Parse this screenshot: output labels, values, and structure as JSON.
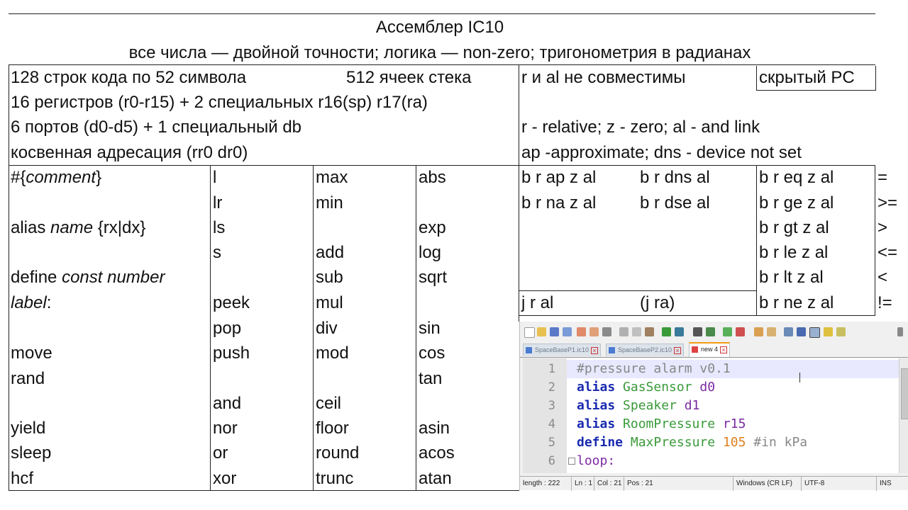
{
  "header": {
    "title": "Ассемблер IC10",
    "subtitle": "все числа — двойной точности;   логика — non-zero;   тригонометрия в радианах"
  },
  "info": {
    "lines_code": "128 строк кода по 52 символа",
    "stack": "512 ячеек стека",
    "registers": "16 регистров (r0-r15) + 2 специальных r16(sp) r17(ra)",
    "ports": "6 портов (d0-d5) + 1 специальный db",
    "indirect": "косвенная адресация (rr0 dr0)",
    "r_al": "r и al не совместимы",
    "hidden_pc": "скрытый PC",
    "legend1": "r - relative;  z - zero;  al - and link",
    "legend2": "ap -approximate;  dns - device not set"
  },
  "col1": {
    "comment_hash": "#{",
    "comment_word": "comment",
    "comment_end": "}",
    "alias_kw": "alias ",
    "alias_name": "name",
    "alias_args": " {rx|dx}",
    "define_kw": "define ",
    "define_args": "const number",
    "label_word": "label",
    "label_colon": ":",
    "move": "move",
    "rand": "rand",
    "yield": "yield",
    "sleep": "sleep",
    "hcf": "hcf"
  },
  "col2": {
    "l": "l",
    "lr": "lr",
    "ls": "ls",
    "s": "s",
    "peek": "peek",
    "pop": "pop",
    "push": "push",
    "and": "and",
    "nor": "nor",
    "or": "or",
    "xor": "xor"
  },
  "col3": {
    "max": "max",
    "min": "min",
    "add": "add",
    "sub": "sub",
    "mul": "mul",
    "div": "div",
    "mod": "mod",
    "ceil": "ceil",
    "floor": "floor",
    "round": "round",
    "trunc": "trunc"
  },
  "col4": {
    "abs": "abs",
    "exp": "exp",
    "log": "log",
    "sqrt": "sqrt",
    "sin": "sin",
    "cos": "cos",
    "tan": "tan",
    "asin": "asin",
    "acos": "acos",
    "atan": "atan"
  },
  "branch": {
    "bap": "b r ap z al",
    "bdns": "b r dns al",
    "beq": "b r eq z al",
    "eq_sym": "=",
    "bna": "b r na z al",
    "bdse": "b r dse al",
    "bge": "b r ge z al",
    "ge_sym": ">=",
    "bgt": "b r gt z al",
    "gt_sym": ">",
    "ble": "b r le z al",
    "le_sym": "<=",
    "blt": "b r lt z al",
    "lt_sym": "<",
    "jral": "j r al",
    "jra": "(j ra)",
    "bne": "b r ne z al",
    "ne_sym": "!="
  },
  "editor": {
    "tabs": [
      "SpaceBaseP1.ic10",
      "SpaceBaseP2.ic10",
      "new 4"
    ],
    "line_numbers": [
      "1",
      "2",
      "3",
      "4",
      "5",
      "6"
    ],
    "code": {
      "l1": "#pressure alarm v0.1",
      "l2_kw": "alias",
      "l2_id": " GasSensor",
      "l2_arg": " d0",
      "l3_kw": "alias",
      "l3_id": " Speaker",
      "l3_arg": " d1",
      "l4_kw": "alias",
      "l4_id": " RoomPressure",
      "l4_arg": " r15",
      "l5_kw": "define",
      "l5_id": " MaxPressure",
      "l5_num": " 105",
      "l5_cm": " #in kPa",
      "l6": "loop:"
    },
    "status": {
      "length": "length : 222",
      "ln": "Ln : 1",
      "col": "Col : 21",
      "pos": "Pos : 21",
      "eol": "Windows (CR LF)",
      "encoding": "UTF-8",
      "mode": "INS"
    }
  }
}
